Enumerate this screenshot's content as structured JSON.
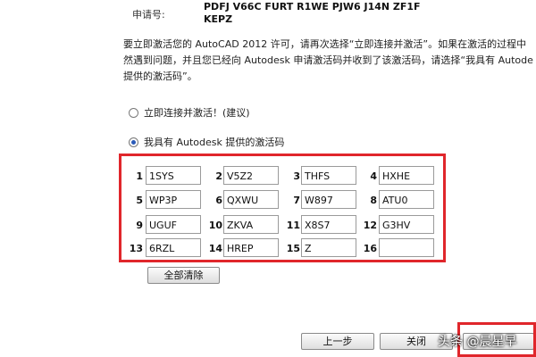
{
  "request": {
    "label": "申请号:",
    "code_line1": "PDFJ V66C FURT R1WE PJW6 J14N ZF1F",
    "code_line2": "KEPZ"
  },
  "instructions": {
    "line1": "要立即激活您的 AutoCAD 2012 许可，请再次选择“立即连接并激活”。如果在激活的过程中",
    "line2": "然遇到问题，并且您已经向 Autodesk 申请激活码并收到了该激活码，请选择“我具有 Autode",
    "line3": "提供的激活码”。"
  },
  "options": {
    "connect": "立即连接并激活！(建议)",
    "have_code": "我具有 Autodesk 提供的激活码",
    "selected": "have_code"
  },
  "activation_fields": [
    {
      "num": "1",
      "value": "1SYS"
    },
    {
      "num": "2",
      "value": "V5Z2"
    },
    {
      "num": "3",
      "value": "THFS"
    },
    {
      "num": "4",
      "value": "HXHE"
    },
    {
      "num": "5",
      "value": "WP3P"
    },
    {
      "num": "6",
      "value": "QXWU"
    },
    {
      "num": "7",
      "value": "W897"
    },
    {
      "num": "8",
      "value": "ATU0"
    },
    {
      "num": "9",
      "value": "UGUF"
    },
    {
      "num": "10",
      "value": "ZKVA"
    },
    {
      "num": "11",
      "value": "X8S7"
    },
    {
      "num": "12",
      "value": "G3HV"
    },
    {
      "num": "13",
      "value": "6RZL"
    },
    {
      "num": "14",
      "value": "HREP"
    },
    {
      "num": "15",
      "value": "Z"
    },
    {
      "num": "16",
      "value": ""
    }
  ],
  "buttons": {
    "clear_all": "全部清除",
    "back": "上一步",
    "close": "关闭"
  },
  "watermark": "头条 @晨星早",
  "colors": {
    "highlight": "#e0262b",
    "radio_selected": "#2b5bb8"
  }
}
